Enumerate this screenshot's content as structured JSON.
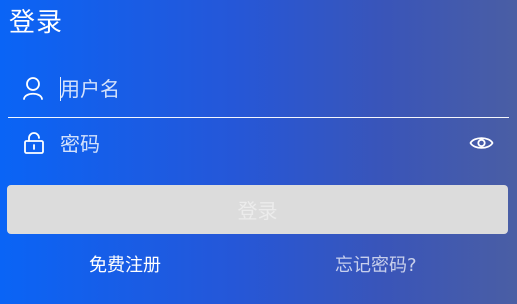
{
  "page": {
    "title": "登录"
  },
  "form": {
    "username": {
      "placeholder": "用户名",
      "value": "",
      "icon": "user-icon"
    },
    "password": {
      "placeholder": "密码",
      "value": "",
      "icon": "lock-icon",
      "toggle_icon": "eye-icon"
    },
    "submit_label": "登录"
  },
  "links": {
    "register": "免费注册",
    "forgot": "忘记密码?"
  },
  "colors": {
    "background_start": "#0a64f6",
    "background_end": "#4a5ea4",
    "button_disabled": "#dcdcdc",
    "text": "#ffffff"
  }
}
